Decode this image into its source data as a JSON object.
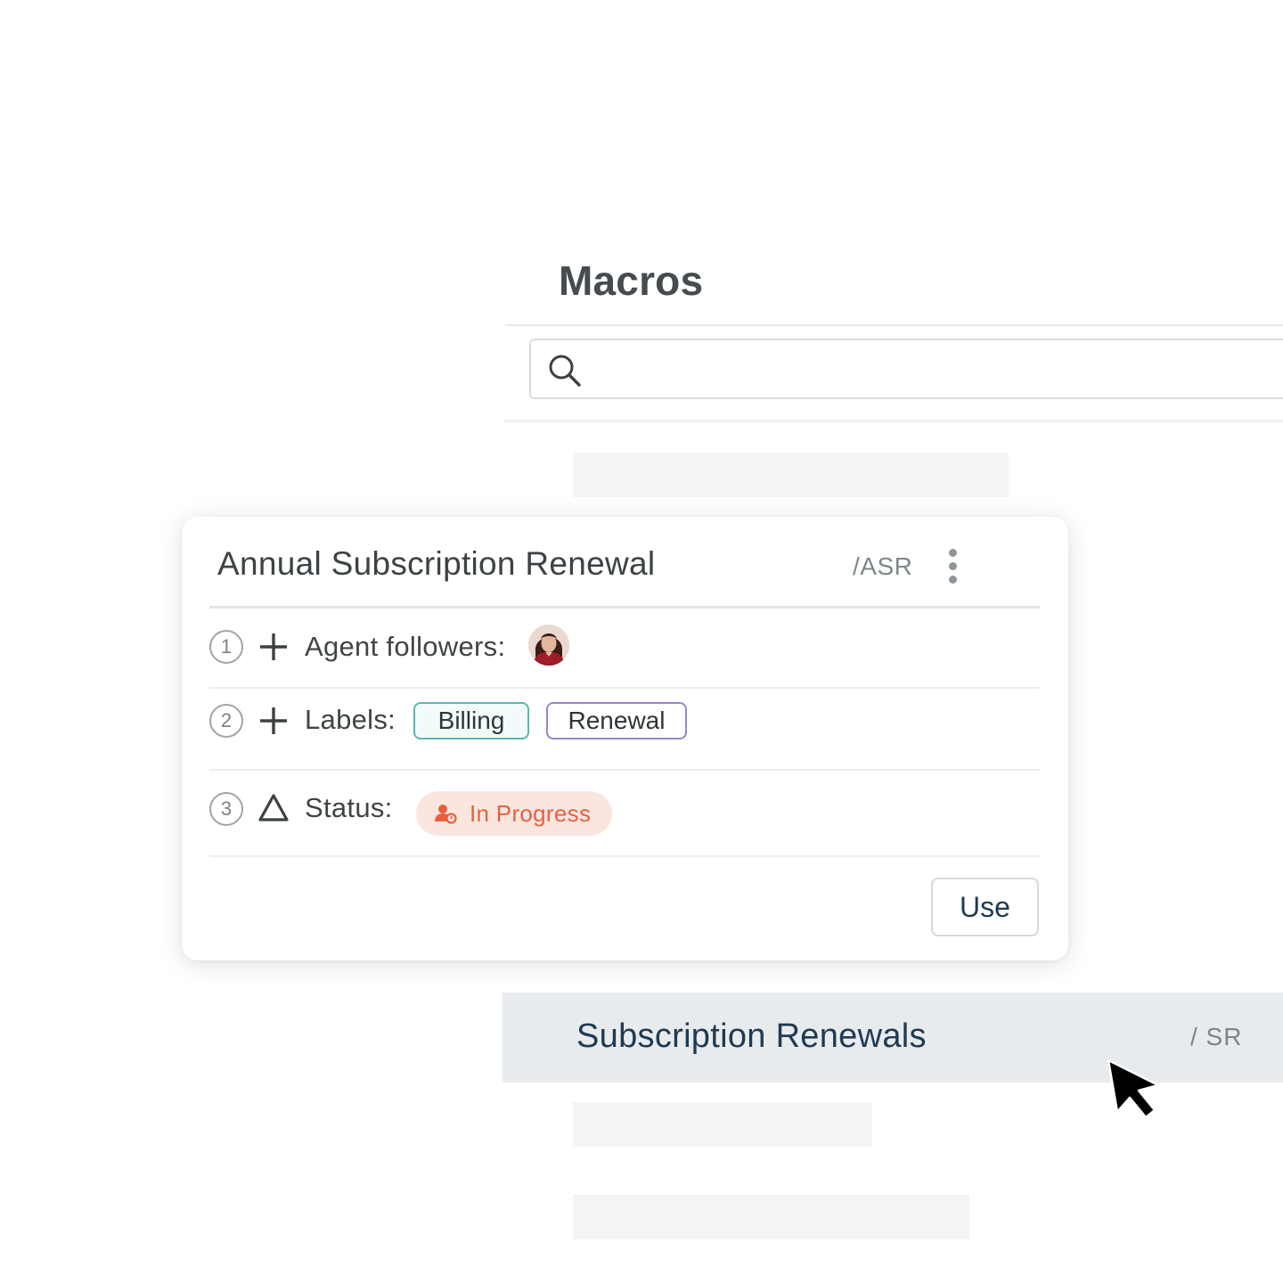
{
  "panel": {
    "title": "Macros",
    "search": {
      "placeholder": "",
      "value": "",
      "icon": "search-icon"
    }
  },
  "macro_card": {
    "title": "Annual Subscription Renewal",
    "shortcut": "/ASR",
    "menu_icon": "kebab-menu-icon",
    "steps": [
      {
        "number": "1",
        "icon": "plus-icon",
        "label": "Agent followers:"
      },
      {
        "number": "2",
        "icon": "plus-icon",
        "label": "Labels:",
        "tags": [
          "Billing",
          "Renewal"
        ]
      },
      {
        "number": "3",
        "icon": "triangle-icon",
        "label": "Status:",
        "status": "In Progress"
      }
    ],
    "use_label": "Use"
  },
  "list": {
    "highlighted_item": {
      "title": "Subscription Renewals",
      "shortcut": "/ SR"
    }
  },
  "colors": {
    "billing_tag_border": "#58b8b0",
    "renewal_tag_border": "#9a86c9",
    "status_bg": "#fbe5df",
    "status_text": "#e8603f",
    "highlight_row_bg": "#e8ebee"
  }
}
